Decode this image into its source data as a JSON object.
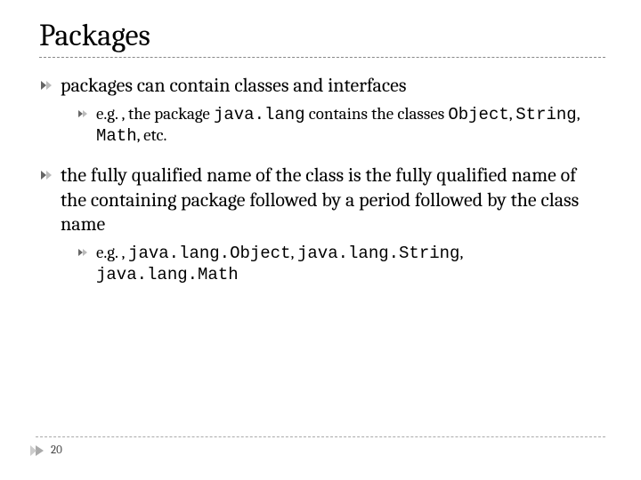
{
  "title": "Packages",
  "bullets": [
    {
      "text": "packages can contain classes and interfaces",
      "sub": [
        {
          "prefix": "e.g. , the package ",
          "code1": "java.lang",
          "mid": " contains the classes ",
          "code2": "Object",
          "sep1": ", ",
          "code3": "String",
          "sep2": ", ",
          "code4": "Math",
          "suffix": ", etc."
        }
      ]
    },
    {
      "text": "the fully qualified name of the class is the fully qualified name of the containing package followed by a period followed by the class name",
      "sub": [
        {
          "prefix": "e.g. , ",
          "code1": "java.lang.Object",
          "sep1": ", ",
          "code2": "java.lang.String",
          "sep2": ", ",
          "code3": "java.lang.Math",
          "code4": "",
          "mid": "",
          "suffix": ""
        }
      ]
    }
  ],
  "page_number": "20"
}
